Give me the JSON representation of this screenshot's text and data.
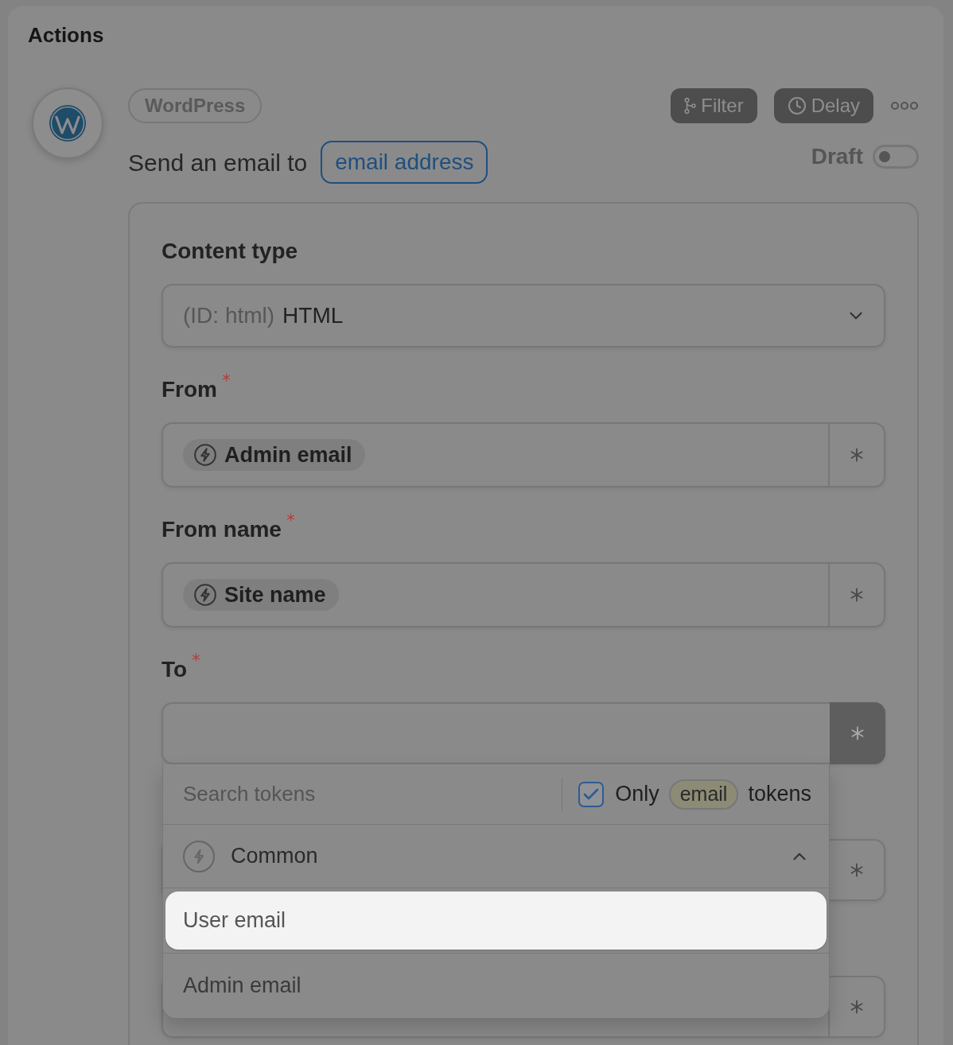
{
  "section": {
    "title": "Actions"
  },
  "action": {
    "app": "WordPress",
    "sentence": "Send an email to",
    "target": "email address",
    "buttons": [
      {
        "kind": "filter",
        "label": "Filter"
      },
      {
        "kind": "delay",
        "label": "Delay"
      }
    ],
    "status": {
      "label": "Draft",
      "on": false
    }
  },
  "form": {
    "fields": [
      {
        "kind": "select",
        "label": "Content type",
        "required": false,
        "value_prefix": "(ID: html)",
        "value": "HTML"
      },
      {
        "kind": "token",
        "label": "From",
        "required": true,
        "focused": false,
        "token": "Admin email"
      },
      {
        "kind": "token",
        "label": "From name",
        "required": true,
        "focused": false,
        "token": "Site name"
      },
      {
        "kind": "token",
        "label": "To",
        "required": true,
        "focused": true
      },
      {
        "kind": "token",
        "focused": false
      },
      {
        "kind": "token",
        "focused": false
      }
    ]
  },
  "token_picker": {
    "search": {
      "placeholder": "Search tokens"
    },
    "filter": {
      "checked": true,
      "prefix": "Only",
      "tag": "email",
      "suffix": "tokens"
    },
    "groups": [
      {
        "name": "Common",
        "expanded": true,
        "items": [
          {
            "label": "User email",
            "selected": true
          },
          {
            "label": "Admin email",
            "selected": false
          }
        ]
      }
    ]
  }
}
